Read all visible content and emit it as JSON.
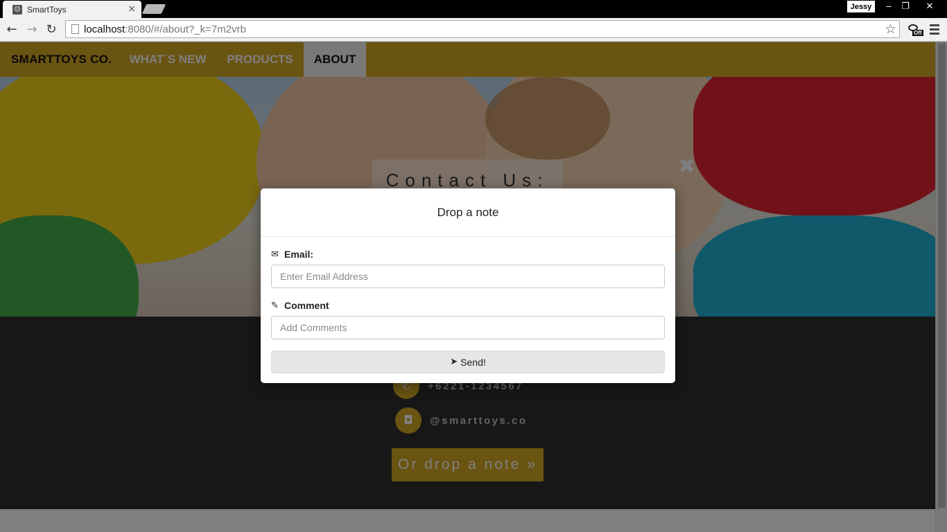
{
  "browser": {
    "tab_title": "SmartToys",
    "tab_close": "×",
    "user": "Jessy",
    "url_host": "localhost",
    "url_rest": ":8080/#/about?_k=7m2vrb",
    "ext_label": "Off"
  },
  "nav": {
    "brand": "SMARTTOYS CO.",
    "links": [
      "WHAT´S NEW",
      "PRODUCTS",
      "ABOUT"
    ],
    "active": "ABOUT"
  },
  "hero": {
    "heading": "Contact Us:",
    "close": "✖"
  },
  "footer": {
    "phone": "+6221-1234567",
    "instagram": "@smarttoys.co",
    "drop_button": "Or drop a note »"
  },
  "modal": {
    "title": "Drop a note",
    "email_label": "Email:",
    "email_placeholder": "Enter Email Address",
    "email_value": "",
    "comment_label": "Comment",
    "comment_placeholder": "Add Comments",
    "comment_value": "",
    "send_label": "Send!"
  },
  "icons": {
    "email": "envelope-icon",
    "comment": "pencil-icon",
    "send": "paper-plane-icon",
    "phone": "phone-icon",
    "instagram": "instagram-icon"
  },
  "colors": {
    "accent": "#d4a925",
    "footer": "#2f2f2f",
    "modal_backdrop": "rgba(0,0,0,0.5)"
  }
}
